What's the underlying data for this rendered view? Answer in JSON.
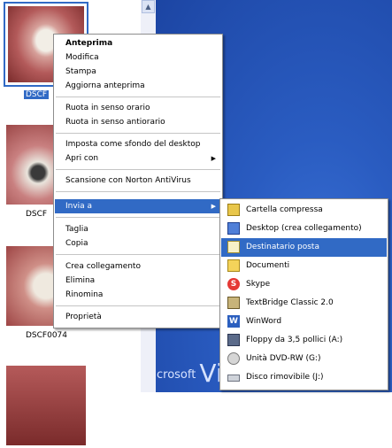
{
  "explorer": {
    "captions": [
      "DSCF",
      "DSCF",
      "DSCF0074"
    ]
  },
  "desktop": {
    "logo_small": "crosoft",
    "logo_big": "Vi"
  },
  "context_menu": {
    "items": [
      {
        "label": "Anteprima",
        "bold": true
      },
      {
        "label": "Modifica"
      },
      {
        "label": "Stampa"
      },
      {
        "label": "Aggiorna anteprima"
      },
      {
        "label": "Ruota in senso orario"
      },
      {
        "label": "Ruota in senso antiorario"
      },
      {
        "label": "Imposta come sfondo del desktop"
      },
      {
        "label": "Apri con",
        "submenu": true
      },
      {
        "label": "Scansione con Norton AntiVirus"
      },
      {
        "label": "Invia a",
        "submenu": true,
        "highlighted": true
      },
      {
        "label": "Taglia"
      },
      {
        "label": "Copia"
      },
      {
        "label": "Crea collegamento"
      },
      {
        "label": "Elimina"
      },
      {
        "label": "Rinomina"
      },
      {
        "label": "Proprietà"
      }
    ],
    "arrow": "▶"
  },
  "send_to_submenu": {
    "items": [
      {
        "label": "Cartella compressa",
        "icon": "zip-folder-icon"
      },
      {
        "label": "Desktop (crea collegamento)",
        "icon": "desktop-icon"
      },
      {
        "label": "Destinatario posta",
        "icon": "mail-recipient-icon",
        "highlighted": true
      },
      {
        "label": "Documenti",
        "icon": "documents-folder-icon"
      },
      {
        "label": "Skype",
        "icon": "skype-icon",
        "glyph": "S"
      },
      {
        "label": "TextBridge Classic 2.0",
        "icon": "textbridge-icon"
      },
      {
        "label": "WinWord",
        "icon": "winword-icon",
        "glyph": "W"
      },
      {
        "label": "Floppy da 3,5 pollici (A:)",
        "icon": "floppy-icon"
      },
      {
        "label": "Unità DVD-RW (G:)",
        "icon": "dvd-drive-icon"
      },
      {
        "label": "Disco rimovibile (J:)",
        "icon": "removable-disk-icon"
      }
    ]
  },
  "colors": {
    "highlight": "#316ac5",
    "desktop": "#2a5cc1"
  }
}
